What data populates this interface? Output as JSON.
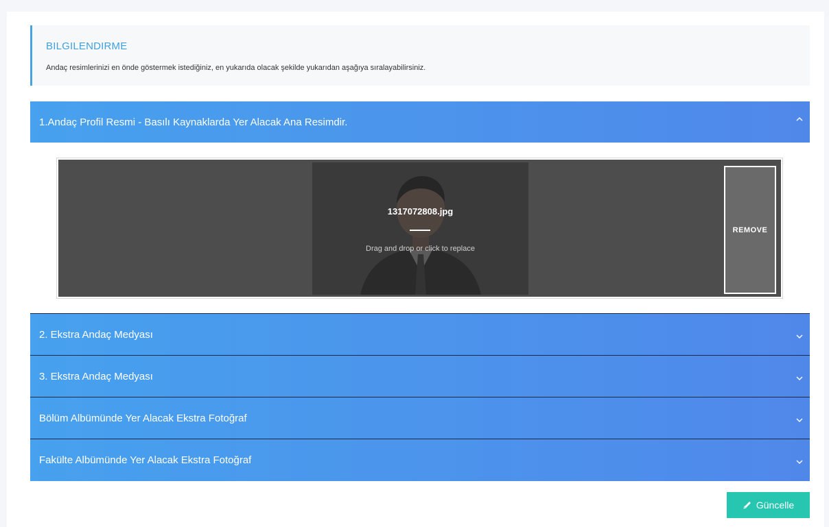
{
  "info": {
    "title": "BILGILENDIRME",
    "text": "Andaç resimlerinizi en önde göstermek istediğiniz, en yukarıda olacak şekilde yukarıdan aşağıya sıralayabilirsiniz."
  },
  "accordion": [
    {
      "label": "1.Andaç Profil Resmi - Basılı Kaynaklarda Yer Alacak Ana Resimdir.",
      "expanded": true,
      "chevron": "chevron-up-icon"
    },
    {
      "label": "2. Ekstra Andaç Medyası",
      "expanded": false,
      "chevron": "chevron-down-icon"
    },
    {
      "label": "3. Ekstra Andaç Medyası",
      "expanded": false,
      "chevron": "chevron-down-icon"
    },
    {
      "label": "Bölüm Albümünde Yer Alacak Ekstra Fotoğraf",
      "expanded": false,
      "chevron": "chevron-down-icon"
    },
    {
      "label": "Fakülte Albümünde Yer Alacak Ekstra Fotoğraf",
      "expanded": false,
      "chevron": "chevron-down-icon"
    }
  ],
  "dropzone": {
    "filename": "1317072808.jpg",
    "hint": "Drag and drop or click to replace",
    "remove_label": "REMOVE"
  },
  "actions": {
    "update_label": "Güncelle",
    "update_icon": "pencil-icon"
  },
  "colors": {
    "accordion_start": "#47a1ee",
    "accordion_end": "#5088ea",
    "info_accent": "#4aa3df",
    "update_button": "#26c6b1"
  }
}
